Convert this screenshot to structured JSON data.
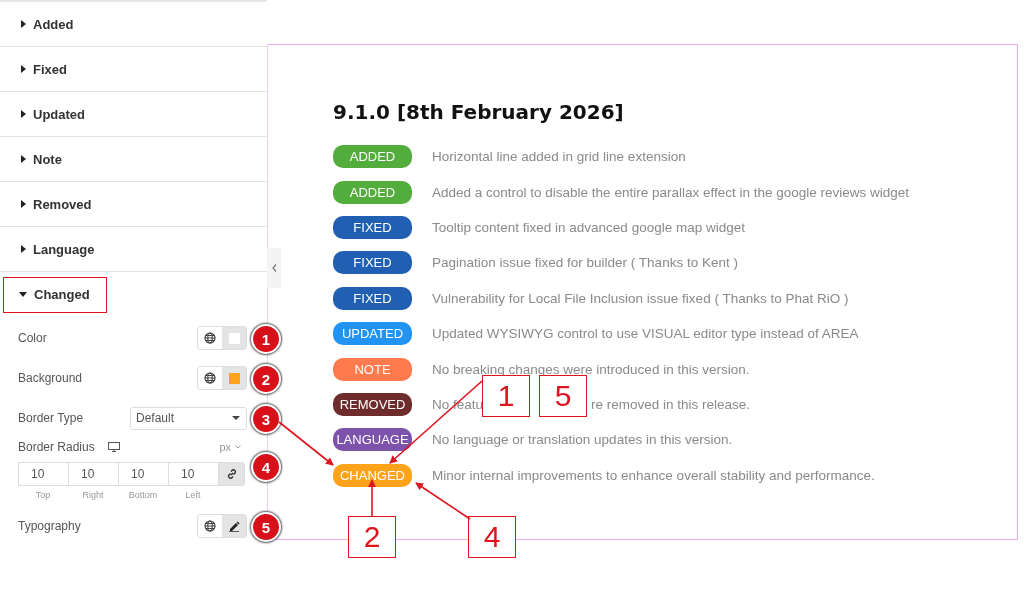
{
  "sidebar": {
    "sections": [
      {
        "label": "Added",
        "expanded": false
      },
      {
        "label": "Fixed",
        "expanded": false
      },
      {
        "label": "Updated",
        "expanded": false
      },
      {
        "label": "Note",
        "expanded": false
      },
      {
        "label": "Removed",
        "expanded": false
      },
      {
        "label": "Language",
        "expanded": false
      },
      {
        "label": "Changed",
        "expanded": true
      }
    ],
    "controls": [
      {
        "kind": "color",
        "label": "Color",
        "color": "#ffffff",
        "marker": "1"
      },
      {
        "kind": "color",
        "label": "Background",
        "color": "#ffa31a",
        "marker": "2"
      },
      {
        "kind": "select",
        "label": "Border Type",
        "value": "Default",
        "marker": "3"
      },
      {
        "kind": "dimensions",
        "label": "Border Radius",
        "unit": "px",
        "marker": "4",
        "fields": [
          {
            "value": "10",
            "caption": "Top"
          },
          {
            "value": "10",
            "caption": "Right"
          },
          {
            "value": "10",
            "caption": "Bottom"
          },
          {
            "value": "10",
            "caption": "Left"
          }
        ]
      },
      {
        "kind": "typography",
        "label": "Typography",
        "marker": "5"
      }
    ]
  },
  "preview": {
    "title": "9.1.0 [8th February 2026]",
    "entries": [
      {
        "badge": "ADDED",
        "color": "#52ad3c",
        "parts": [
          "Horizontal line added in grid line extension"
        ]
      },
      {
        "badge": "ADDED",
        "color": "#52ad3c",
        "parts": [
          "Added a control to disable the entire parallax effect in the google reviews widget"
        ]
      },
      {
        "badge": "FIXED",
        "color": "#215fb3",
        "parts": [
          "Tooltip content fixed in advanced google map widget"
        ]
      },
      {
        "badge": "FIXED",
        "color": "#215fb3",
        "parts": [
          "Pagination issue fixed for builder ( Thanks to Kent )"
        ]
      },
      {
        "badge": "FIXED",
        "color": "#215fb3",
        "parts": [
          "Vulnerability for Local File Inclusion issue fixed ( Thanks to Phat RiO )"
        ]
      },
      {
        "badge": "UPDATED",
        "color": "#2193f3",
        "parts": [
          "Updated WYSIWYG control to use VISUAL editor type instead of AREA"
        ]
      },
      {
        "badge": "NOTE",
        "color": "#ff7a4c",
        "parts": [
          "No breaking changes were introduced in this version."
        ]
      },
      {
        "badge": "REMOVED",
        "color": "#6e2c2c",
        "parts": [
          "No featu",
          "re removed in this release."
        ]
      },
      {
        "badge": "LANGUAGE",
        "color": "#7c52ab",
        "parts": [
          "No language or translation updates in this version."
        ]
      },
      {
        "badge": "CHANGED",
        "color": "#ffa31a",
        "parts": [
          "Minor internal improvements to enhance overall stability and performance."
        ]
      }
    ]
  },
  "callouts": [
    {
      "label": "1"
    },
    {
      "label": "5"
    },
    {
      "label": "2"
    },
    {
      "label": "4"
    }
  ]
}
